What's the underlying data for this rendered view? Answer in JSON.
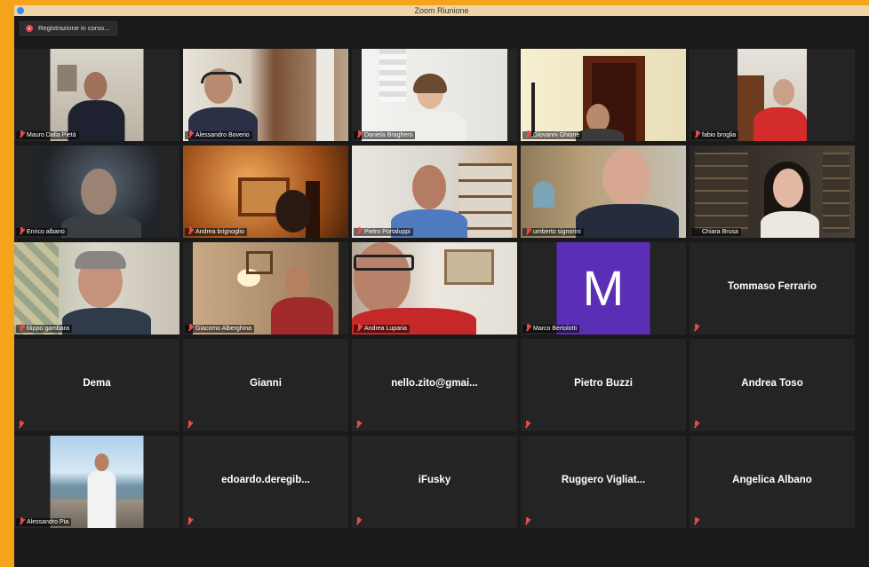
{
  "window": {
    "title": "Zoom Riunione"
  },
  "recording": {
    "label": "Registrazione in corso..."
  },
  "participants": [
    {
      "name": "Mauro Dalla Pietà"
    },
    {
      "name": "Alessandro Boverio"
    },
    {
      "name": "Daniela Braghero"
    },
    {
      "name": "Giovanni Ghione"
    },
    {
      "name": "fabio broglia"
    },
    {
      "name": "Enrico albano"
    },
    {
      "name": "Andrea brignoglio"
    },
    {
      "name": "Pietro Portaluppi"
    },
    {
      "name": "umberto signorini"
    },
    {
      "name": "Chiara Brusa"
    },
    {
      "name": "filippo gambara"
    },
    {
      "name": "Giacomo Alberghina"
    },
    {
      "name": "Andrea Luparia"
    },
    {
      "name": "Marco Bertolotti",
      "avatar_letter": "M",
      "avatar_color": "#5b2fb5"
    },
    {
      "name": "Tommaso Ferrario"
    },
    {
      "name": "Dema"
    },
    {
      "name": "Gianni"
    },
    {
      "name": "nello.zito@gmai..."
    },
    {
      "name": "Pietro Buzzi"
    },
    {
      "name": "Andrea Toso"
    },
    {
      "name": "Alessandro Pia"
    },
    {
      "name": "edoardo.deregib..."
    },
    {
      "name": "iFusky"
    },
    {
      "name": "Ruggero Vigliat..."
    },
    {
      "name": "Angelica Albano"
    }
  ],
  "colors": {
    "accent_border": "#d8e87c",
    "muted_mic": "#e84c4c",
    "background": "#1a1a1a"
  }
}
